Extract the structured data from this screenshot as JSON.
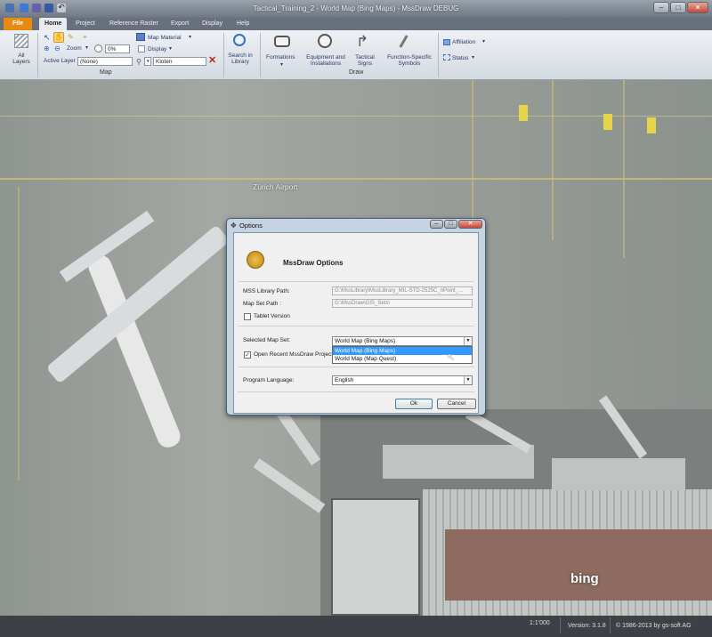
{
  "window": {
    "title": "Tactical_Training_2 - World Map (Bing Maps) - MssDraw DEBUG"
  },
  "tabs": [
    "File",
    "Home",
    "Project",
    "Reference Raster",
    "Export",
    "Display",
    "Help"
  ],
  "ribbon": {
    "all_layers": "All\nLayers",
    "zoom": "Zoom",
    "active_layer_label": "Active Layer",
    "active_layer_value": "(None)",
    "opacity_value": "0%",
    "map_material": "Map Material",
    "display": "Display",
    "search_value": "Kloten",
    "map_group": "Map",
    "search_in_library": "Search in\nLibrary",
    "formations": "Formations",
    "equipment": "Equipment and\nInstallations",
    "tactical_signs": "Tactical\nSigns",
    "function_symbols": "Function-Specific\nSymbols",
    "draw_group": "Draw",
    "affiliation": "Affiliation",
    "status": "Status"
  },
  "map": {
    "airport_label": "Zürich Airport",
    "bing_logo": "bing"
  },
  "dialog": {
    "title": "Options",
    "heading": "MssDraw Options",
    "mss_library_label": "MSS Library Path:",
    "mss_library_value": "G:\\MssLibrary\\MssLibrary_MIL-STD-2525C_nPoint_...",
    "map_set_label": "Map Set Path :",
    "map_set_value": "G:\\MssDraw\\GIS_Sets\\",
    "tablet_label": "Tablet Version",
    "selected_map_set_label": "Selected Map Set:",
    "selected_map_set_value": "World Map (Bing Maps)",
    "map_set_options": [
      "World Map (Bing Maps)",
      "World Map (Map Quest)"
    ],
    "open_recent_label": "Open Recent MssDraw Project (",
    "program_language_label": "Program Language:",
    "program_language_value": "English",
    "ok": "Ok",
    "cancel": "Cancel"
  },
  "statusbar": {
    "scale": "1:1'000",
    "version": "Version: 3.1.8",
    "copyright": "© 1986-2013 by gs-soft AG"
  },
  "colors": {
    "file_tab": "#e78a12",
    "selection": "#3399ff",
    "titlebar": "#7d8691"
  }
}
